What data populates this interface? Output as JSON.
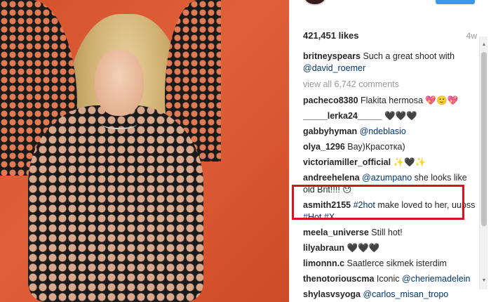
{
  "post": {
    "likes": "421,451 likes",
    "age": "4w",
    "caption_user": "britneyspears",
    "caption_text": " Such a great shoot with ",
    "caption_mention": "@david_roemer",
    "view_all": "view all 6,742 comments"
  },
  "comments": [
    {
      "user": "pacheco8380",
      "text": " Flakita hermosa 💖🙂💖",
      "mention": ""
    },
    {
      "user": "_____lerka24_____",
      "text": " 🖤🖤🖤",
      "mention": ""
    },
    {
      "user": "gabbyhyman",
      "text": " ",
      "mention": "@ndeblasio"
    },
    {
      "user": "olya_1296",
      "text": " Вау)Красотка)",
      "mention": ""
    },
    {
      "user": "victoriamiller_official",
      "text": " ✨🖤✨",
      "mention": ""
    },
    {
      "user": "andreehelena",
      "text": " ",
      "mention": "@azumpano",
      "text2": " she looks like old Brit!!!! 😯"
    },
    {
      "user": "asmith2155",
      "text": " ",
      "mention": "#2hot",
      "text2": " make loved to her, uupss ",
      "mention2": "#Hot #X"
    },
    {
      "user": "meela_universe",
      "text": " Still hot!",
      "mention": ""
    },
    {
      "user": "lilyabraun",
      "text": " 🖤🖤🖤",
      "mention": ""
    },
    {
      "user": "limonnn.c",
      "text": " Saatlerce sikmek isterdim",
      "mention": ""
    },
    {
      "user": "thenotoriouscma",
      "text": " Iconic ",
      "mention": "@cheriemadelein"
    },
    {
      "user": "shylasvsyoga",
      "text": " ",
      "mention": "@carlos_misan_tropo"
    }
  ],
  "colors": {
    "accent_blue": "#3897f0",
    "mention_blue": "#003569",
    "highlight_red": "#d2151e",
    "photo_bg": "#d4522b"
  }
}
